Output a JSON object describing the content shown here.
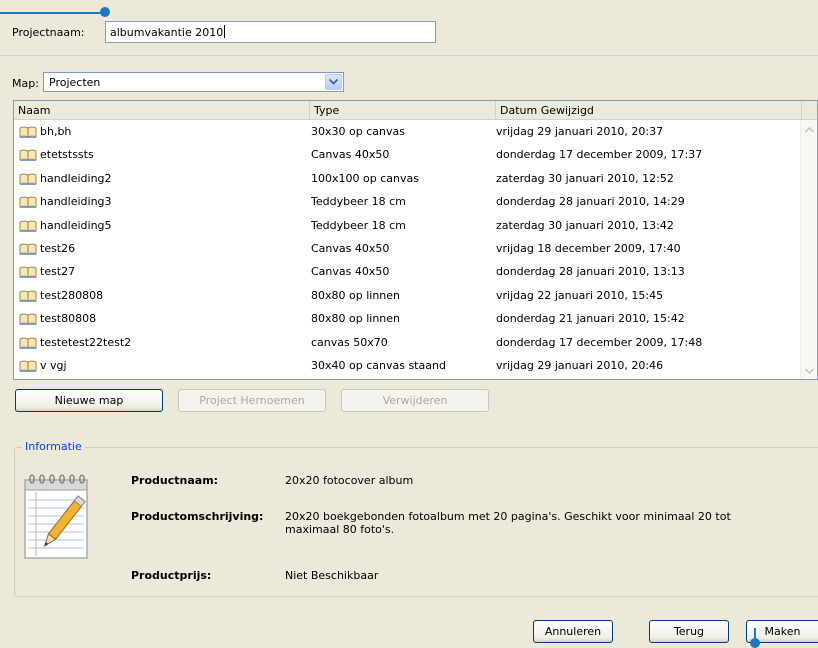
{
  "project": {
    "name_label": "Projectnaam:",
    "name_value": "albumvakantie 2010"
  },
  "folder": {
    "label": "Map:",
    "selected": "Projecten"
  },
  "list": {
    "columns": [
      "Naam",
      "Type",
      "Datum Gewijzigd"
    ],
    "rows": [
      {
        "name": "bh,bh",
        "type": "30x30 op canvas",
        "date": "vrijdag 29 januari 2010, 20:37"
      },
      {
        "name": "etetstssts",
        "type": "Canvas 40x50",
        "date": "donderdag 17 december 2009, 17:37"
      },
      {
        "name": "handleiding2",
        "type": "100x100 op canvas",
        "date": "zaterdag 30 januari 2010, 12:52"
      },
      {
        "name": "handleiding3",
        "type": "Teddybeer 18 cm",
        "date": "donderdag 28 januari 2010, 14:29"
      },
      {
        "name": "handleiding5",
        "type": "Teddybeer 18 cm",
        "date": "zaterdag 30 januari 2010, 13:42"
      },
      {
        "name": "test26",
        "type": "Canvas 40x50",
        "date": "vrijdag 18 december 2009, 17:40"
      },
      {
        "name": "test27",
        "type": "Canvas 40x50",
        "date": "donderdag 28 januari 2010, 13:13"
      },
      {
        "name": "test280808",
        "type": "80x80 op linnen",
        "date": "vrijdag 22 januari 2010, 15:45"
      },
      {
        "name": "test80808",
        "type": "80x80 op linnen",
        "date": "donderdag 21 januari 2010, 15:42"
      },
      {
        "name": "testetest22test2",
        "type": "canvas 50x70",
        "date": "donderdag 17 december 2009, 17:48"
      },
      {
        "name": "v vgj",
        "type": "30x40 op canvas staand",
        "date": "vrijdag 29 januari 2010, 20:46"
      }
    ]
  },
  "actions": {
    "new_folder": "Nieuwe map",
    "rename": "Project Hernoemen",
    "delete": "Verwijderen"
  },
  "info": {
    "title": "Informatie",
    "product_name_label": "Productnaam:",
    "product_name": "20x20 fotocover album",
    "description_label": "Productomschrijving:",
    "description": "20x20 boekgebonden fotoalbum met 20 pagina's. Geschikt voor minimaal 20 tot maximaal 80 foto's.",
    "price_label": "Productprijs:",
    "price": "Niet Beschikbaar"
  },
  "footer": {
    "cancel": "Annuleren",
    "back": "Terug",
    "create": "Maken"
  },
  "colors": {
    "dialog_bg": "#ece9d8",
    "callout": "#1c79c0",
    "group_title": "#0046d5"
  }
}
